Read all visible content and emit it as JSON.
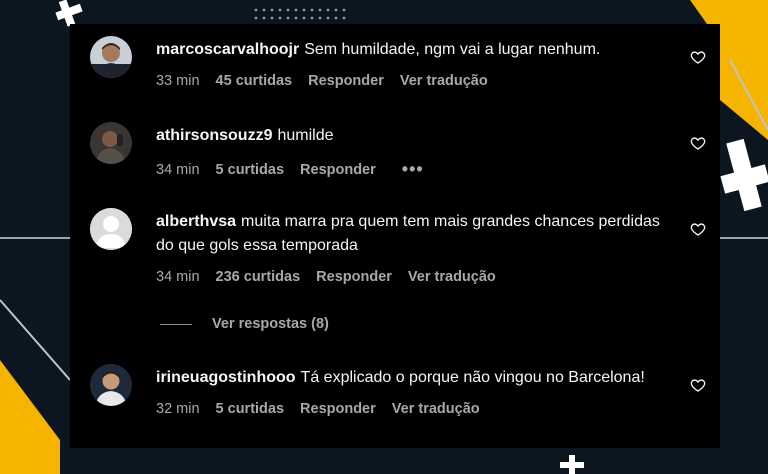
{
  "comments": [
    {
      "username": "marcoscarvalhoojr",
      "text": "Sem humildade, ngm vai a lugar nenhum.",
      "time": "33 min",
      "likes": "45 curtidas",
      "reply": "Responder",
      "translate": "Ver tradução",
      "avatar_icon": "profile-photo"
    },
    {
      "username": "athirsonsouzz9",
      "text": "humilde",
      "time": "34 min",
      "likes": "5 curtidas",
      "reply": "Responder",
      "more": "•••",
      "avatar_icon": "profile-photo"
    },
    {
      "username": "alberthvsa",
      "text": "muita marra pra quem tem mais grandes chances perdidas do que gols essa temporada",
      "time": "34 min",
      "likes": "236 curtidas",
      "reply": "Responder",
      "translate": "Ver tradução",
      "avatar_icon": "default-avatar"
    },
    {
      "username": "irineuagostinhooo",
      "text": "Tá explicado o porque não vingou no Barcelona!",
      "time": "32 min",
      "likes": "5 curtidas",
      "reply": "Responder",
      "translate": "Ver tradução",
      "avatar_icon": "profile-photo"
    }
  ],
  "view_replies": "Ver respostas (8)",
  "colors": {
    "panel": "#000000",
    "text": "#f5f5f5",
    "muted": "#a8a8a8",
    "accent_yellow": "#f5b400",
    "background": "#0b1620"
  }
}
